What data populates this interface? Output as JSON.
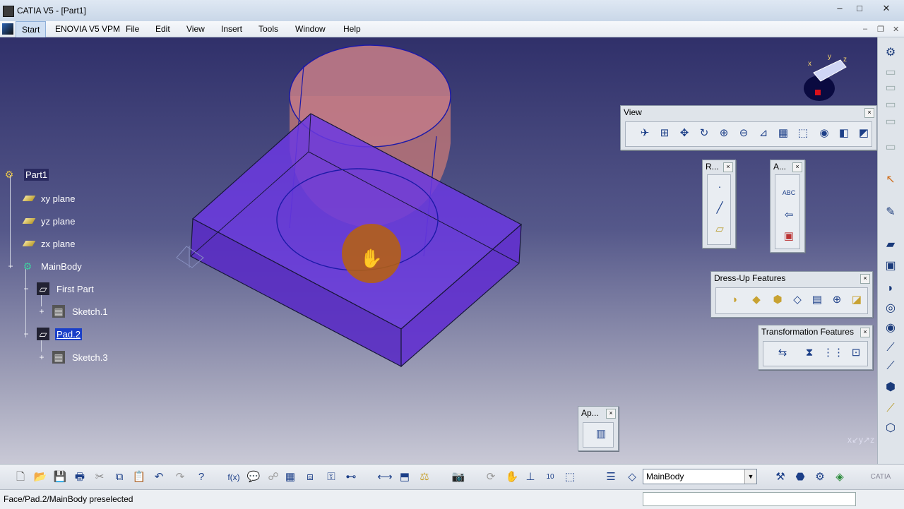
{
  "window": {
    "title": "CATIA V5 - [Part1]",
    "controls": {
      "minimize": "–",
      "maximize": "□",
      "close": "✕"
    }
  },
  "menubar": {
    "items": [
      "Start",
      "ENOVIA V5 VPM",
      "File",
      "Edit",
      "View",
      "Insert",
      "Tools",
      "Window",
      "Help"
    ],
    "mdi_controls": {
      "minimize": "–",
      "restore": "❐",
      "close": "✕"
    }
  },
  "tree": {
    "root": "Part1",
    "planes": [
      "xy plane",
      "yz plane",
      "zx plane"
    ],
    "body": "MainBody",
    "features": [
      {
        "name": "First Part",
        "child": "Sketch.1"
      },
      {
        "name": "Pad.2",
        "child": "Sketch.3",
        "selected": true
      }
    ]
  },
  "panels": {
    "view": {
      "title": "View"
    },
    "r": {
      "title": "R..."
    },
    "a": {
      "title": "A..."
    },
    "dressup": {
      "title": "Dress-Up Features"
    },
    "transformation": {
      "title": "Transformation Features"
    },
    "ap": {
      "title": "Ap..."
    },
    "close_glyph": "×"
  },
  "compass": {
    "x": "x",
    "y": "y",
    "z": "z"
  },
  "triad_label": "x↙y↗z",
  "toolbar": {
    "current_body": "MainBody",
    "logo": "CATIA"
  },
  "statusbar": {
    "message": "Face/Pad.2/MainBody preselected"
  },
  "colors": {
    "viewport_top": "#30306a",
    "part_fill": "#6a33d8",
    "cylinder_fill": "#c87070",
    "edge": "#1a1a6a",
    "selection": "#1a3fc8"
  }
}
